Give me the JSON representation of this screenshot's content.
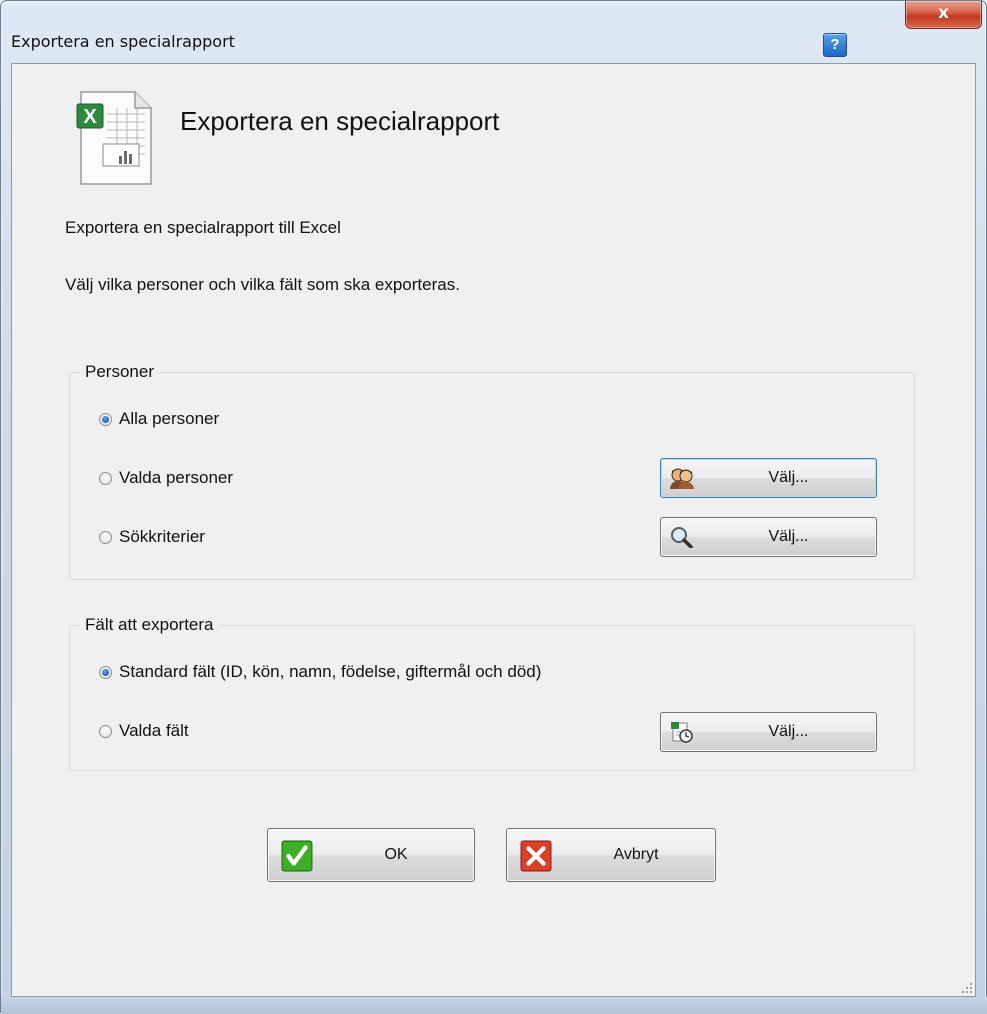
{
  "window": {
    "title": "Exportera en specialrapport",
    "help_label": "?",
    "close_label": "x"
  },
  "header": {
    "heading": "Exportera en specialrapport",
    "icon": "excel-document-icon"
  },
  "description": {
    "line1": "Exportera en specialrapport  till Excel",
    "line2": "Välj vilka personer och vilka fält som ska exporteras."
  },
  "persons_group": {
    "title": "Personer",
    "options": [
      {
        "label": "Alla personer",
        "checked": true
      },
      {
        "label": "Valda personer",
        "checked": false
      },
      {
        "label": "Sökkriterier",
        "checked": false
      }
    ],
    "select_persons_button": {
      "label": "Välj...",
      "icon": "people-icon"
    },
    "search_criteria_button": {
      "label": "Välj...",
      "icon": "magnifier-icon"
    }
  },
  "fields_group": {
    "title": "Fält att exportera",
    "options": [
      {
        "label": "Standard fält (ID, kön, namn, födelse, giftermål och död)",
        "checked": true
      },
      {
        "label": "Valda fält",
        "checked": false
      }
    ],
    "select_fields_button": {
      "label": "Välj...",
      "icon": "field-list-icon"
    }
  },
  "footer": {
    "ok_label": "OK",
    "cancel_label": "Avbryt"
  },
  "colors": {
    "ok_green": "#3fae29",
    "cancel_red": "#d9402a",
    "radio_blue": "#1c5fc0"
  }
}
